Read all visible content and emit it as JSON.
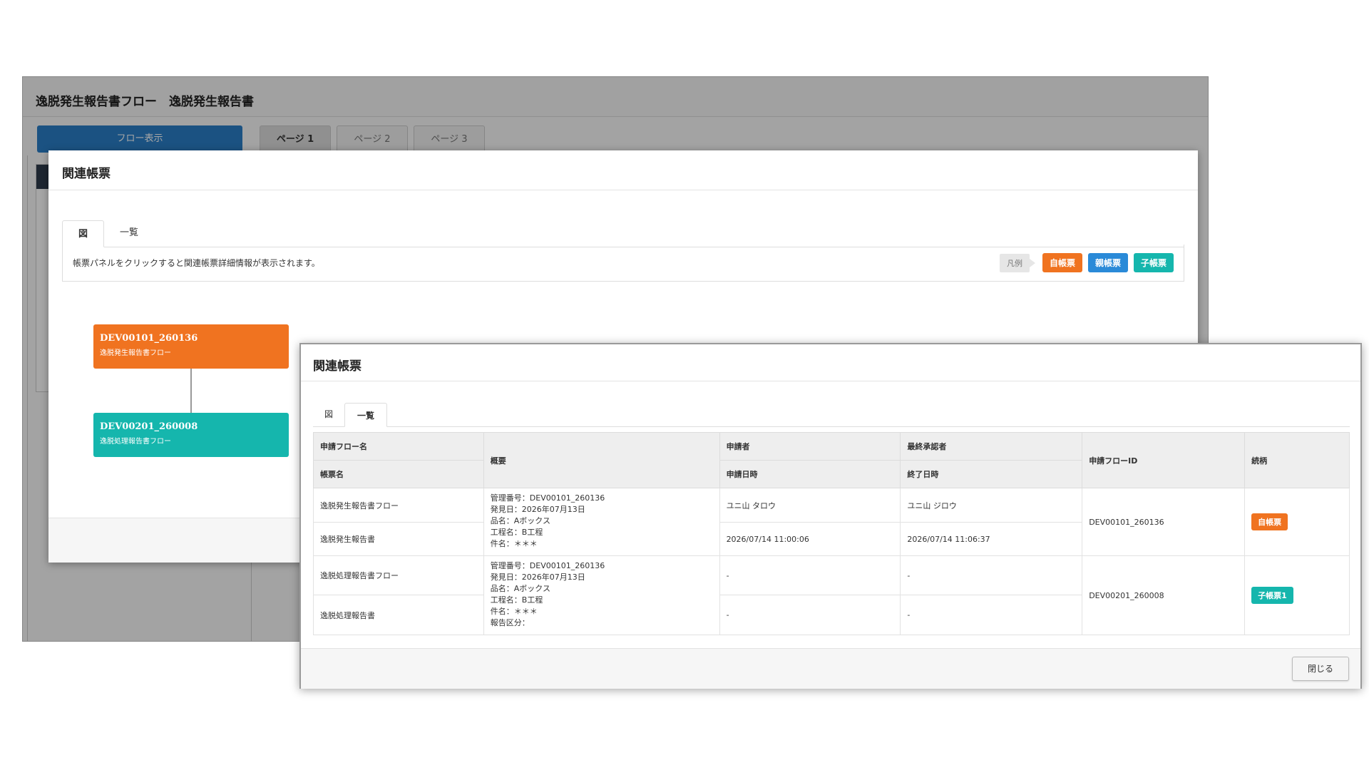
{
  "background": {
    "title": "逸脱発生報告書フロー　逸脱発生報告書",
    "flow_button": "フロー表示",
    "page_tabs": [
      "ページ 1",
      "ページ 2",
      "ページ 3"
    ]
  },
  "modal_diagram": {
    "title": "関連帳票",
    "tabs": [
      "図",
      "一覧"
    ],
    "message": "帳票パネルをクリックすると関連帳票詳細情報が表示されます。",
    "legend": {
      "label": "凡例",
      "self": "自帳票",
      "parent": "親帳票",
      "child": "子帳票"
    },
    "nodes": [
      {
        "id": "DEV00101_260136",
        "name": "逸脱発生報告書フロー",
        "color": "#f07320"
      },
      {
        "id": "DEV00201_260008",
        "name": "逸脱処理報告書フロー",
        "color": "#15b6ad"
      }
    ]
  },
  "modal_list": {
    "title": "関連帳票",
    "tabs": [
      "図",
      "一覧"
    ],
    "headers": {
      "flow_name": "申請フロー名",
      "form_name": "帳票名",
      "summary": "概要",
      "applicant": "申請者",
      "applied_at": "申請日時",
      "final_approver": "最終承認者",
      "finished_at": "終了日時",
      "flow_id": "申請フローID",
      "relation": "続柄"
    },
    "rows": [
      {
        "flow_name": "逸脱発生報告書フロー",
        "form_name": "逸脱発生報告書",
        "summary": [
          "管理番号：DEV00101_260136",
          "発見日：2026年07月13日",
          "品名：Aボックス",
          "工程名：B工程",
          "件名：＊＊＊"
        ],
        "applicant": "ユニ山 タロウ",
        "applied_at": "2026/07/14 11:00:06",
        "final_approver": "ユニ山 ジロウ",
        "finished_at": "2026/07/14 11:06:37",
        "flow_id": "DEV00101_260136",
        "relation": "自帳票"
      },
      {
        "flow_name": "逸脱処理報告書フロー",
        "form_name": "逸脱処理報告書",
        "summary": [
          "管理番号：DEV00101_260136",
          "発見日：2026年07月13日",
          "品名：Aボックス",
          "工程名：B工程",
          "件名：＊＊＊",
          "報告区分："
        ],
        "applicant": "-",
        "applied_at": "-",
        "final_approver": "-",
        "finished_at": "-",
        "flow_id": "DEV00201_260008",
        "relation": "子帳票1"
      }
    ],
    "close_button": "閉じる"
  },
  "colors": {
    "self": "#f07320",
    "parent": "#2a8ad8",
    "child": "#15b6ad",
    "primary": "#2a7fc8"
  }
}
